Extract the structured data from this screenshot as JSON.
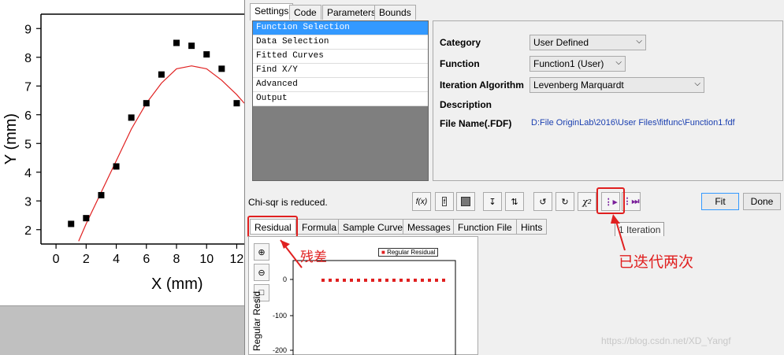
{
  "chart_data": {
    "type": "scatter",
    "xlabel": "X (mm)",
    "ylabel": "Y (mm)",
    "x_ticks": [
      "0",
      "2",
      "4",
      "6",
      "8",
      "10",
      "12"
    ],
    "y_ticks": [
      "2",
      "3",
      "4",
      "5",
      "6",
      "7",
      "8",
      "9"
    ],
    "xlim": [
      -1,
      12.5
    ],
    "ylim": [
      1.5,
      9.5
    ],
    "points": [
      [
        1,
        2.2
      ],
      [
        2,
        2.4
      ],
      [
        3,
        3.2
      ],
      [
        4,
        4.2
      ],
      [
        5,
        5.9
      ],
      [
        6,
        6.4
      ],
      [
        7,
        7.4
      ],
      [
        8,
        8.5
      ],
      [
        9,
        8.4
      ],
      [
        10,
        8.1
      ],
      [
        11,
        7.6
      ],
      [
        12,
        6.4
      ]
    ],
    "fit_curve": [
      [
        1.5,
        1.6
      ],
      [
        2,
        2.2
      ],
      [
        3,
        3.3
      ],
      [
        4,
        4.4
      ],
      [
        5,
        5.5
      ],
      [
        6,
        6.4
      ],
      [
        7,
        7.1
      ],
      [
        8,
        7.6
      ],
      [
        9,
        7.7
      ],
      [
        10,
        7.6
      ],
      [
        11,
        7.2
      ],
      [
        12,
        6.7
      ],
      [
        12.5,
        6.4
      ]
    ],
    "point_color": "#000000",
    "curve_color": "#e02020"
  },
  "dialog": {
    "tabs": [
      "Settings",
      "Code",
      "Parameters",
      "Bounds"
    ],
    "list_items": [
      "Function Selection",
      "Data Selection",
      "Fitted Curves",
      "Find X/Y",
      "Advanced",
      "Output"
    ],
    "fields": {
      "category_label": "Category",
      "category_value": "User Defined",
      "function_label": "Function",
      "function_value": "Function1 (User)",
      "iteration_label": "Iteration Algorithm",
      "iteration_value": "Levenberg Marquardt",
      "description_label": "Description",
      "filename_label": "File Name(.FDF)",
      "filename_value": "D:File OriginLab\\2016\\User Files\\fitfunc\\Function1.fdf"
    },
    "status": "Chi-sqr is reduced.",
    "fit_button": "Fit",
    "done_button": "Done",
    "tooltip": "1 Iteration",
    "bottom_tabs": [
      "Residual",
      "Formula",
      "Sample Curve",
      "Messages",
      "Function File",
      "Hints"
    ]
  },
  "residual_chart": {
    "legend": "Regular Residual",
    "ylabel": "Regular Resid",
    "y_ticks": [
      "0",
      "-100",
      "-200"
    ]
  },
  "annotations": {
    "residual_note": "残差",
    "iteration_note": "已迭代两次"
  },
  "watermark": "https://blog.csdn.net/XD_Yangf",
  "accent": "#e02020"
}
